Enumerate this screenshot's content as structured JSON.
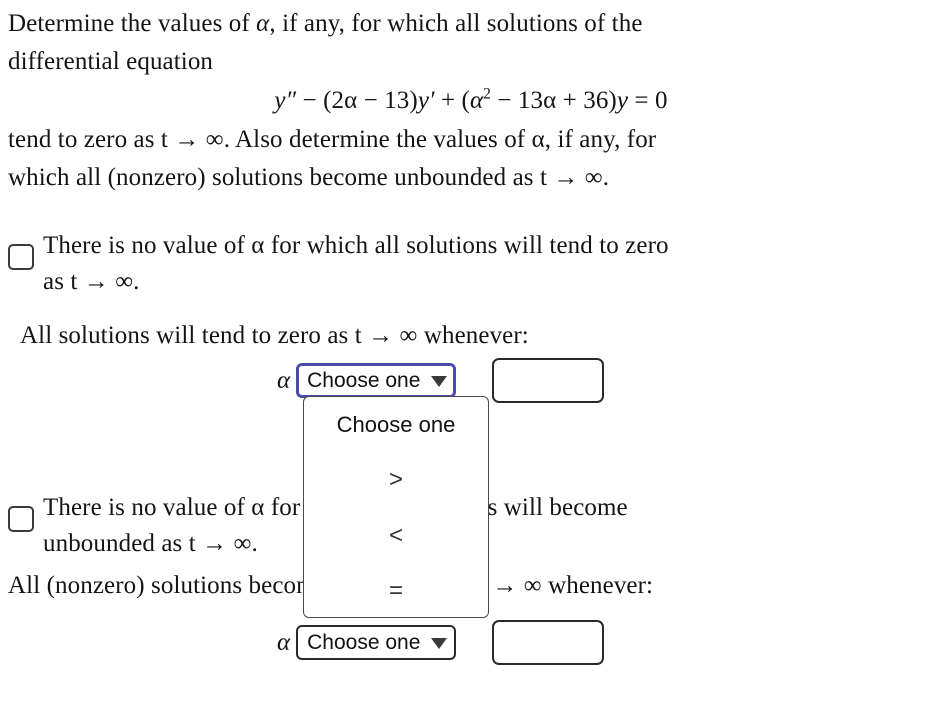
{
  "problem": {
    "intro_line_1": "Determine the values of ",
    "intro_alpha": "α",
    "intro_line_1b": ", if any, for which all solutions of the",
    "intro_line_2": "differential equation",
    "equation": {
      "full": "y″ − (2α − 13)y′ + (α² − 13α + 36)y = 0",
      "lhs_y2prime": "y″",
      "minus": "−",
      "group1": "(2α − 13)",
      "yprime": "y′",
      "plus": "+",
      "group2_open": "(",
      "alpha": "α",
      "exponent": "2",
      "group2_rest": " − 13α + 36)",
      "y": "y",
      "equals": "= 0"
    },
    "after_eq_line_1": "tend to zero as t → ∞. Also determine the values of α, if any, for",
    "after_eq_line_2": "which all (nonzero) solutions become unbounded as t → ∞."
  },
  "part_a": {
    "checkbox_label_line_1": "There is no value of α for which all solutions will tend to zero",
    "checkbox_label_line_2": "as t → ∞.",
    "checkbox_checked": false,
    "statement": "All solutions will tend to zero as t → ∞ whenever:",
    "alpha_symbol": "α",
    "select_value": "Choose one",
    "input_value": "",
    "input_placeholder": ""
  },
  "part_b": {
    "checkbox_label_line_1": "There is no value of α for which all solutions will become",
    "checkbox_label_line_2": "unbounded as t → ∞.",
    "checkbox_checked": false,
    "statement": "All (nonzero) solutions become unbounded as t → ∞ whenever:",
    "alpha_symbol": "α",
    "select_value": "Choose one",
    "input_value": "",
    "input_placeholder": ""
  },
  "dropdown": {
    "open": true,
    "options": [
      {
        "label": "Choose one",
        "kind": "placeholder"
      },
      {
        "label": ">",
        "kind": "symbol"
      },
      {
        "label": "<",
        "kind": "symbol"
      },
      {
        "label": "=",
        "kind": "symbol"
      }
    ]
  },
  "colors": {
    "focus_border": "#4b4ba6",
    "control_border": "#2a2a2a",
    "text": "#141414",
    "background": "#ffffff"
  }
}
